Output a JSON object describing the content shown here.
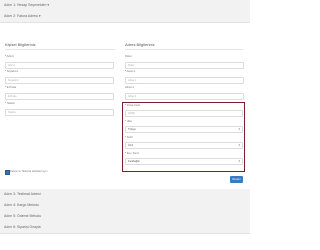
{
  "steps": [
    {
      "label": "Adım 1: Hesap Seçenekleri ▾"
    },
    {
      "label": "Adım 2: Fatura Adresi ▾"
    },
    {
      "label": "Adım 3: Teslimat Adresi"
    },
    {
      "label": "Adım 4: Kargo Metodu"
    },
    {
      "label": "Adım 5: Ödeme Metodu"
    },
    {
      "label": "Adım 6: Siparişi Onayla"
    }
  ],
  "personal": {
    "title": "Kişisel Bilgileriniz",
    "fields": [
      {
        "label": "Adınız",
        "placeholder": "Adınız"
      },
      {
        "label": "Soyadınız",
        "placeholder": "Soyadınız"
      },
      {
        "label": "E-Posta",
        "placeholder": "E-Posta"
      },
      {
        "label": "Telefon",
        "placeholder": "Telefon"
      }
    ]
  },
  "address": {
    "title": "Adres Bilgileriniz",
    "fields": [
      {
        "label": "Şirket",
        "placeholder": "Şirket"
      },
      {
        "label": "Adres 1",
        "placeholder": "Adres 1"
      },
      {
        "label": "Adres 2",
        "placeholder": "Adres 2"
      },
      {
        "label": "Posta Kodu",
        "placeholder": "10000"
      },
      {
        "label": "Ülke",
        "value": "Türkiye"
      },
      {
        "label": "Şehir",
        "value": "İzmir"
      },
      {
        "label": "İlçe / Semt",
        "value": "Karabağlar"
      }
    ]
  },
  "same_address_label": "Fatura ve Teslimat adresleri aynı",
  "continue_label": "Devam"
}
